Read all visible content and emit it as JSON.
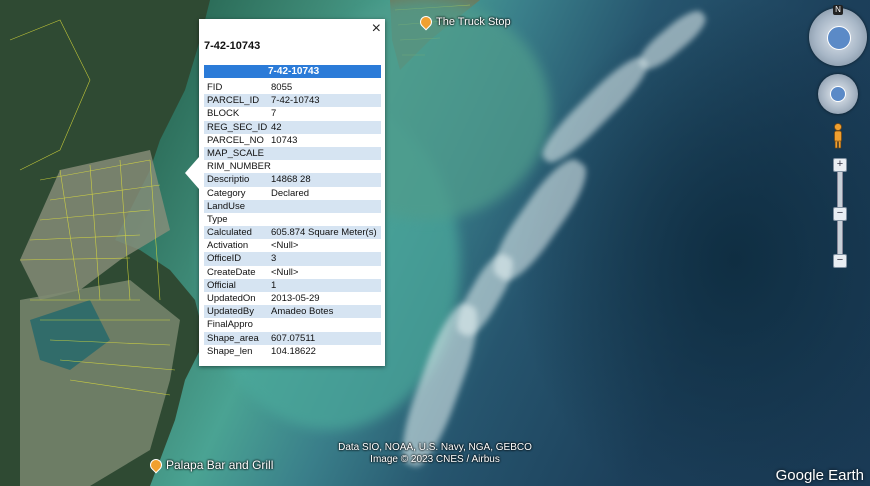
{
  "popup": {
    "title": "7-42-10743",
    "header_value": "7-42-10743",
    "close_label": "×",
    "rows": [
      {
        "key": "FID",
        "value": "8055"
      },
      {
        "key": "PARCEL_ID",
        "value": "7-42-10743"
      },
      {
        "key": "BLOCK",
        "value": "7"
      },
      {
        "key": "REG_SEC_ID",
        "value": "42"
      },
      {
        "key": "PARCEL_NO",
        "value": "10743"
      },
      {
        "key": "MAP_SCALE",
        "value": ""
      },
      {
        "key": "RIM_NUMBER",
        "value": ""
      },
      {
        "key": "Descriptio",
        "value": "14868 28"
      },
      {
        "key": "Category",
        "value": "Declared"
      },
      {
        "key": "LandUse",
        "value": ""
      },
      {
        "key": "Type",
        "value": ""
      },
      {
        "key": "Calculated",
        "value": "605.874 Square Meter(s)"
      },
      {
        "key": "Activation",
        "value": "<Null>"
      },
      {
        "key": "OfficeID",
        "value": "3"
      },
      {
        "key": "CreateDate",
        "value": "<Null>"
      },
      {
        "key": "Official",
        "value": "1"
      },
      {
        "key": "UpdatedOn",
        "value": "2013-05-29"
      },
      {
        "key": "UpdatedBy",
        "value": "Amadeo Botes"
      },
      {
        "key": "FinalAppro",
        "value": ""
      },
      {
        "key": "Shape_area",
        "value": "607.07511"
      },
      {
        "key": "Shape_len",
        "value": "104.18622"
      }
    ]
  },
  "places": {
    "truck_stop": "The Truck Stop",
    "palapa": "Palapa Bar and Grill"
  },
  "attribution": {
    "line1": "Data SIO, NOAA, U.S. Navy, NGA, GEBCO",
    "line2": "Image © 2023 CNES / Airbus"
  },
  "brand": "Google Earth",
  "compass_label": "N",
  "colors": {
    "header_blue": "#2b7bd8",
    "row_alt": "#d6e4f2",
    "pin": "#f0a030"
  },
  "icons": [
    "close-icon",
    "compass-icon",
    "look-around-icon",
    "pegman-icon",
    "zoom-in-icon",
    "zoom-out-icon",
    "location-pin-icon"
  ]
}
